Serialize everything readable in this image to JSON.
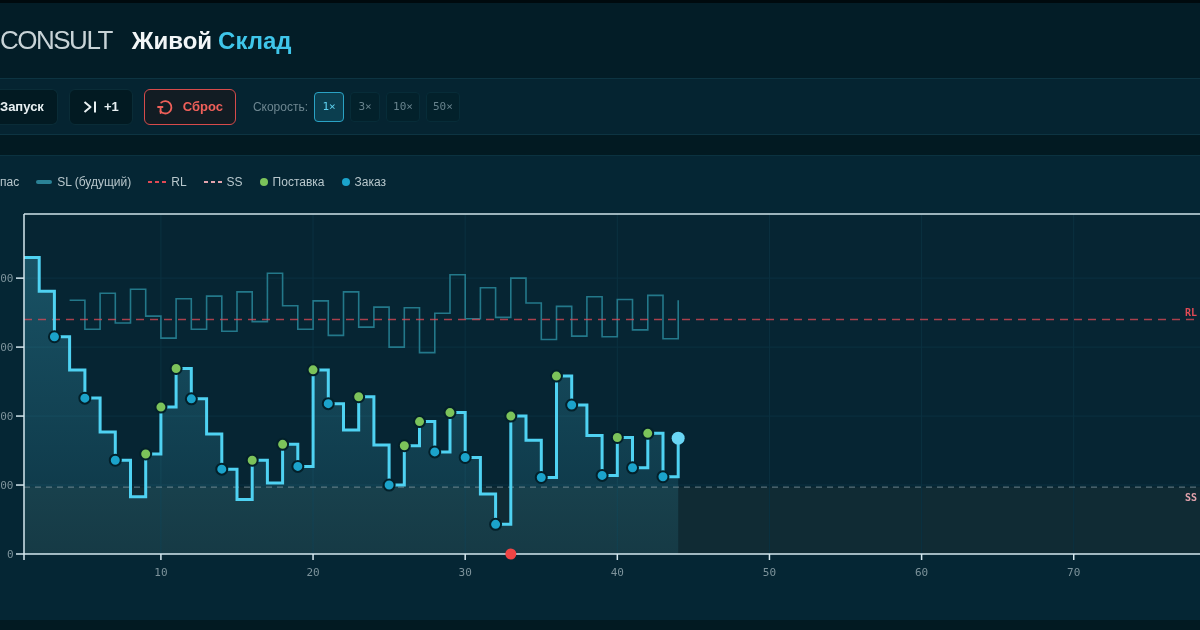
{
  "header": {
    "logo": "CONSULT",
    "title": "Живой",
    "title_accent": "Склад"
  },
  "toolbar": {
    "buttons": [
      {
        "label": "Запуск",
        "kind": "run"
      },
      {
        "label": "+1",
        "kind": "step"
      },
      {
        "label": "Сброс",
        "kind": "reset"
      }
    ],
    "speed": {
      "label": "Скорость:",
      "options": [
        {
          "label": "1×",
          "selected": true
        },
        {
          "label": "3×",
          "selected": false
        },
        {
          "label": "10×",
          "selected": false
        },
        {
          "label": "50×",
          "selected": false
        }
      ]
    }
  },
  "chart": {
    "legend": [
      {
        "label": "пас",
        "kind": "text"
      },
      {
        "label": "SL (будущий)",
        "kind": "line",
        "color": "#2b8296"
      },
      {
        "label": "RL",
        "kind": "dashed",
        "color": "#e04a55"
      },
      {
        "label": "SS",
        "kind": "dashed",
        "color": "#e3a3ad"
      },
      {
        "label": "Поставка",
        "kind": "dot",
        "color": "#7cc35a"
      },
      {
        "label": "Заказ",
        "kind": "dot",
        "color": "#1ba3cb"
      }
    ],
    "y_axis_labels": [
      "00",
      "00",
      "00",
      "00",
      "0"
    ],
    "x_axis_labels": [
      "10",
      "20",
      "30",
      "40",
      "50",
      "60",
      "70"
    ],
    "line_labels": [
      {
        "text": "RL",
        "kind": "reorder",
        "color": "#e04a55"
      },
      {
        "text": "SS",
        "kind": "safety",
        "color": "#e3a3ad"
      }
    ]
  }
}
